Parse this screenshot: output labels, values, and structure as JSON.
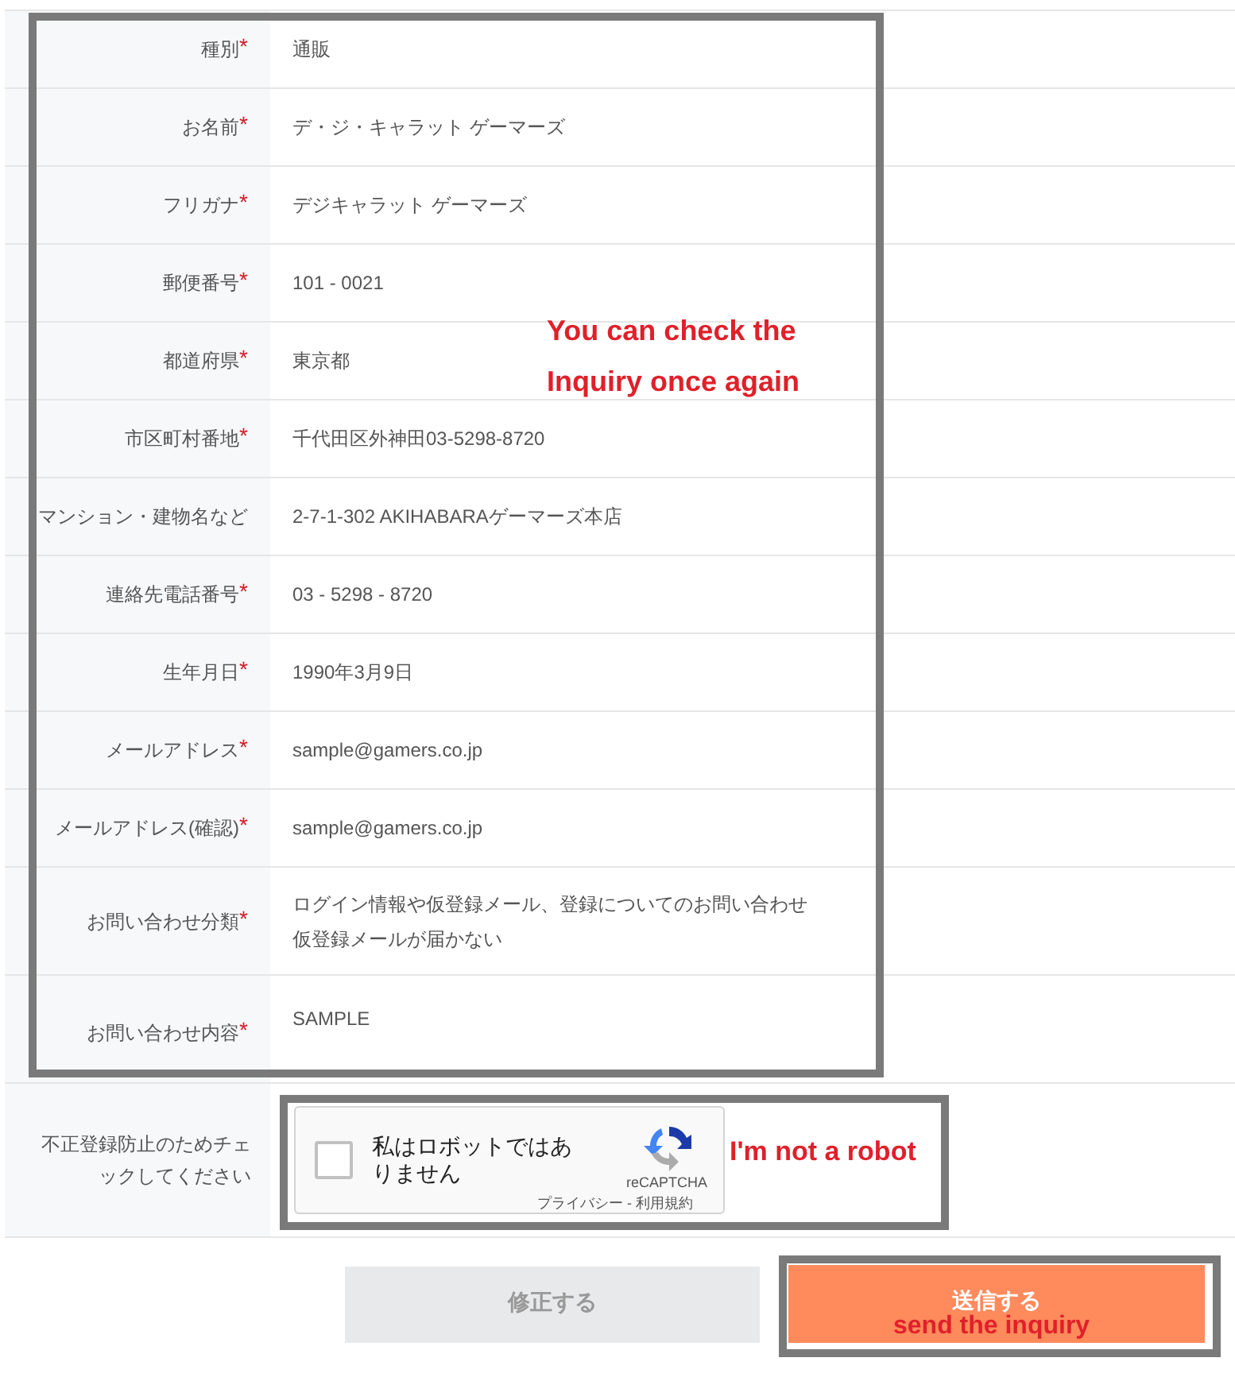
{
  "rows": [
    {
      "label": "種別",
      "mark": "*",
      "kind": "text",
      "value": [
        "通販"
      ]
    },
    {
      "label": "お名前",
      "mark": "*",
      "kind": "text",
      "value": [
        "デ・ジ・キャラット ゲーマーズ"
      ]
    },
    {
      "label": "フリガナ",
      "mark": "*",
      "kind": "text",
      "value": [
        "デジキャラット ゲーマーズ"
      ]
    },
    {
      "label": "郵便番号",
      "mark": "*",
      "kind": "text",
      "value": [
        "101 - 0021"
      ]
    },
    {
      "label": "都道府県",
      "mark": "*",
      "kind": "text",
      "value": [
        "東京都"
      ]
    },
    {
      "label": "市区町村番地",
      "mark": "*",
      "kind": "text",
      "value": [
        "千代田区外神田03-5298-8720"
      ]
    },
    {
      "label": "マンション・建物名など",
      "kind": "text",
      "value": [
        "2-7-1-302 AKIHABARAゲーマーズ本店"
      ]
    },
    {
      "label": "連絡先電話番号",
      "mark": "*",
      "kind": "text",
      "value": [
        "03 - 5298 - 8720"
      ]
    },
    {
      "label": "生年月日",
      "mark": "*",
      "kind": "text",
      "value": [
        "1990年3月9日"
      ]
    },
    {
      "label": "メールアドレス",
      "mark": "*",
      "kind": "text",
      "value": [
        "sample@gamers.co.jp"
      ]
    },
    {
      "label": "メールアドレス(確認)",
      "mark": "*",
      "kind": "text",
      "value": [
        "sample@gamers.co.jp"
      ]
    },
    {
      "label": "お問い合わせ分類",
      "mark": "*",
      "kind": "multiline",
      "value": [
        "ログイン情報や仮登録メール、登録についてのお問い合わせ",
        "仮登録メールが届かない"
      ]
    },
    {
      "label": "お問い合わせ内容",
      "mark": "*",
      "kind": "textarea",
      "value": [
        "SAMPLE"
      ]
    }
  ],
  "captcha_row": {
    "label": "不正登録防止のためチェックしてください",
    "checked": false,
    "text": "私はロボットではありません",
    "brand": "reCAPTCHA",
    "links": "プライバシー - 利用規約"
  },
  "buttons": [
    {
      "label": "修正する",
      "kind": "secondary"
    },
    {
      "label": "送信する",
      "kind": "primary"
    }
  ],
  "annotations": [
    "You can check the Inquiry once again",
    "I'm not a robot",
    "send the inquiry"
  ]
}
